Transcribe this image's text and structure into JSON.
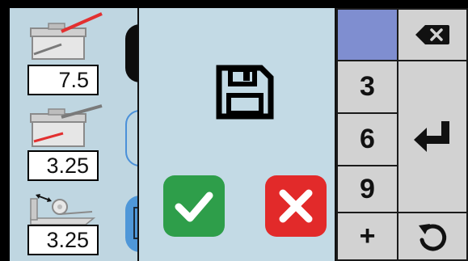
{
  "parameters": [
    {
      "icon": "box-with-red-line-top-icon",
      "value": "7.5"
    },
    {
      "icon": "box-with-red-line-side-icon",
      "value": "3.25"
    },
    {
      "icon": "spool-width-measure-icon",
      "value": "3.25"
    }
  ],
  "dialog": {
    "icon": "floppy-disk-save-icon",
    "confirm_icon": "checkmark-icon",
    "cancel_icon": "x-icon"
  },
  "keypad": {
    "keys": [
      "3",
      "6",
      "9",
      "+"
    ],
    "backspace_icon": "backspace-icon",
    "enter_icon": "enter-arrow-icon",
    "reset_icon": "refresh-icon"
  },
  "colors": {
    "background": "#bfd6e1",
    "confirm": "#2e9e4a",
    "cancel": "#e22a2a",
    "key": "#d2d2d2",
    "key_highlight": "#7f8ed0",
    "accent_blue": "#4f97d8"
  }
}
